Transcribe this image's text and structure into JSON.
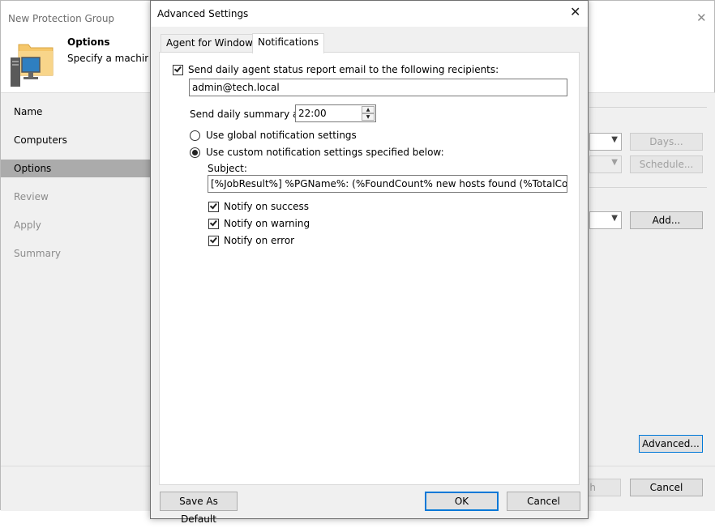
{
  "background_window": {
    "title": "New Protection Group",
    "header_heading": "Options",
    "header_description": "Specify a machine d",
    "nav": [
      {
        "label": "Name",
        "state": "done"
      },
      {
        "label": "Computers",
        "state": "done"
      },
      {
        "label": "Options",
        "state": "active"
      },
      {
        "label": "Review",
        "state": "disabled"
      },
      {
        "label": "Apply",
        "state": "disabled"
      },
      {
        "label": "Summary",
        "state": "disabled"
      }
    ],
    "days_button": "Days...",
    "schedule_button": "Schedule...",
    "add_button": "Add...",
    "advanced_button": "Advanced...",
    "finish_button_partial": "h",
    "cancel_button": "Cancel"
  },
  "dialog": {
    "title": "Advanced Settings",
    "tabs": [
      {
        "label": "Agent for Windows",
        "active": false
      },
      {
        "label": "Notifications",
        "active": true
      }
    ],
    "send_report_label": "Send daily agent status report email to the following recipients:",
    "send_report_checked": true,
    "recipients_value": "admin@tech.local",
    "summary_time_label": "Send daily summary at:",
    "summary_time_value": "22:00",
    "radio_global_label": "Use global notification settings",
    "radio_custom_label": "Use custom notification settings specified below:",
    "selected_radio": "custom",
    "subject_label": "Subject:",
    "subject_value": "[%JobResult%] %PGName%: (%FoundCount% new hosts found (%TotalCount% tot",
    "notify_success_label": "Notify on success",
    "notify_warning_label": "Notify on warning",
    "notify_error_label": "Notify on error",
    "notify_success_checked": true,
    "notify_warning_checked": true,
    "notify_error_checked": true,
    "save_default_button": "Save As Default",
    "ok_button": "OK",
    "cancel_button": "Cancel"
  },
  "colors": {
    "active_nav_bg": "#ababab",
    "default_button_border": "#0078d7",
    "folder_yellow": "#f5c76b"
  },
  "icons": {
    "window_close": "close-icon",
    "header_graphic": "computer-folder-icon",
    "dropdown": "chevron-down-icon",
    "spin_up": "arrow-up-icon",
    "spin_down": "arrow-down-icon"
  }
}
